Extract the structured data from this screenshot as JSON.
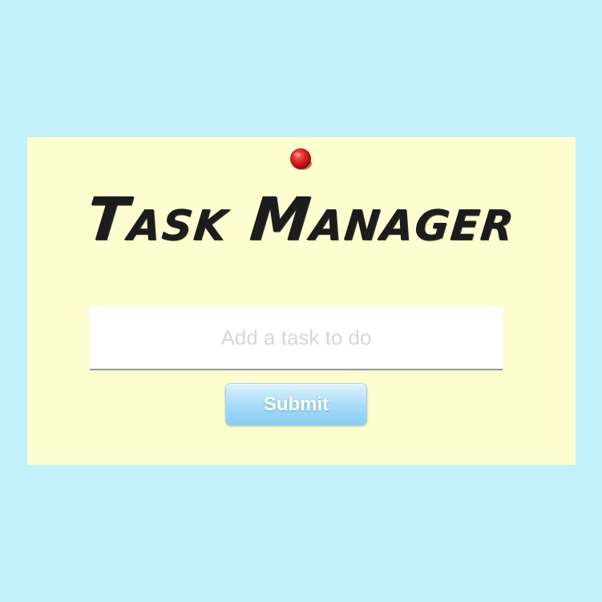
{
  "app": {
    "title": "Task Manager"
  },
  "task_form": {
    "input_value": "",
    "input_placeholder": "Add a task to do",
    "submit_label": "Submit"
  },
  "colors": {
    "background": "#c2f1fb",
    "note": "#fdfdd0",
    "pin": "#d41f1f",
    "title_text": "#1c1c1c",
    "button": "#a9dcf8"
  },
  "icons": {
    "pin": "push-pin-icon"
  }
}
